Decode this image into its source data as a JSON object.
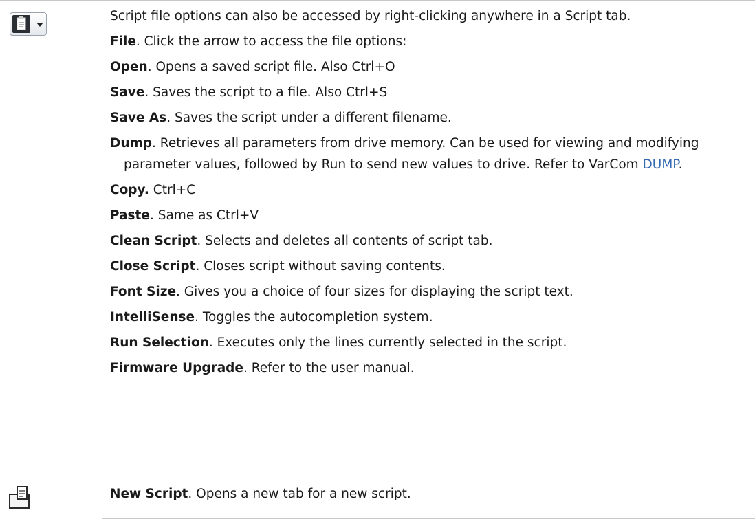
{
  "rows": [
    {
      "icon": "script-file-menu-icon",
      "paragraphs": [
        {
          "bold": "",
          "text": "Script file options can also be accessed by right-clicking anywhere in a Script tab."
        },
        {
          "bold": "File",
          "text": ". Click the arrow to access the file options:"
        },
        {
          "bold": "Open",
          "text": ". Opens a saved script file. Also Ctrl+O"
        },
        {
          "bold": "Save",
          "text": ". Saves the script to a file. Also Ctrl+S"
        },
        {
          "bold": "Save As",
          "text": ". Saves the script under a different filename."
        },
        {
          "bold": "Dump",
          "text": ". Retrieves all parameters from drive memory. Can be used for viewing and modifying parameter values, followed by Run to send new values to drive. Refer to VarCom ",
          "link": "DUMP",
          "after": "."
        },
        {
          "bold": "Copy.",
          "text": " Ctrl+C"
        },
        {
          "bold": "Paste",
          "text": ". Same as Ctrl+V"
        },
        {
          "bold": "Clean Script",
          "text": ". Selects and deletes all contents of script tab."
        },
        {
          "bold": "Close Script",
          "text": ". Closes script without saving contents."
        },
        {
          "bold": "Font Size",
          "text": ". Gives you a choice of four sizes for displaying the script text."
        },
        {
          "bold": "IntelliSense",
          "text": ". Toggles the autocompletion system."
        },
        {
          "bold": "Run Selection",
          "text": ". Executes only the lines currently selected in the script."
        },
        {
          "bold": "Firmware Upgrade",
          "text": ". Refer to the user manual."
        }
      ]
    },
    {
      "icon": "new-script-icon",
      "paragraphs": [
        {
          "bold": "New Script",
          "text": ". Opens a new tab for a new script."
        }
      ]
    }
  ],
  "colors": {
    "link": "#3369b3",
    "border": "#c8c8c8"
  }
}
